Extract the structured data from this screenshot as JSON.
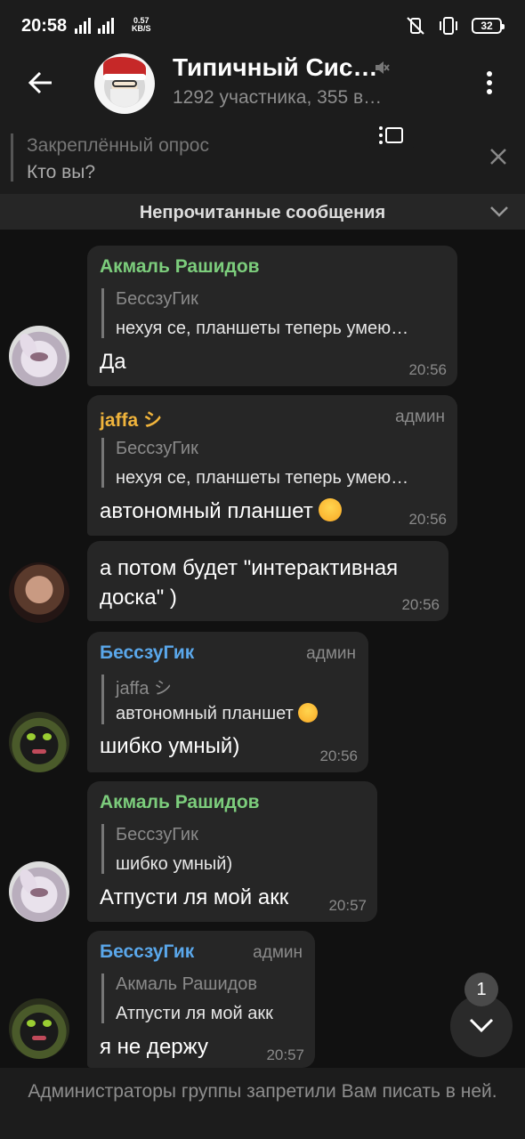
{
  "status_bar": {
    "time": "20:58",
    "network": "4G",
    "speed_value": "0.57",
    "speed_unit": "KB/S",
    "battery": "32"
  },
  "header": {
    "title": "Типичный Сис…",
    "subtitle": "1292 участника, 355 в…"
  },
  "pinned": {
    "title": "Закреплённый опрос",
    "text": "Кто вы?"
  },
  "unread_label": "Непрочитанные сообщения",
  "messages": [
    {
      "sender": "Акмаль Рашидов",
      "sender_color": "#7ccd7c",
      "role": "",
      "quote_name": "БессзуГик",
      "quote_text": "нехуя се, планшеты теперь умею…",
      "text": "Да",
      "time": "20:56"
    },
    {
      "sender": "jaffa シ",
      "sender_color": "#f0b43c",
      "role": "админ",
      "quote_name": "БессзуГик",
      "quote_text": "нехуя се, планшеты теперь умею…",
      "text": "автономный планшет",
      "emoji": "laughing-emoji",
      "time": "20:56"
    },
    {
      "text": "а потом будет \"интерактивная доска\" )",
      "time": "20:56"
    },
    {
      "sender": "БессзуГик",
      "sender_color": "#5aa7ea",
      "role": "админ",
      "quote_name": "jaffa シ",
      "quote_text": "автономный планшет",
      "text": "шибко умный)",
      "time": "20:56"
    },
    {
      "sender": "Акмаль Рашидов",
      "sender_color": "#7ccd7c",
      "role": "",
      "quote_name": "БессзуГик",
      "quote_text": "шибко умный)",
      "text": "Атпусти ля мой акк",
      "time": "20:57"
    },
    {
      "sender": "БессзуГик",
      "sender_color": "#5aa7ea",
      "role": "админ",
      "quote_name": "Акмаль Рашидов",
      "quote_text": "Атпусти ля мой акк",
      "text": "я не держу",
      "time": "20:57"
    }
  ],
  "scroll_badge": "1",
  "footer_text": "Администраторы группы запретили Вам писать в ней.",
  "icons": [
    "back-arrow-icon",
    "mute-icon",
    "more-vert-icon",
    "pinned-list-icon",
    "close-icon",
    "chevron-down-icon"
  ]
}
